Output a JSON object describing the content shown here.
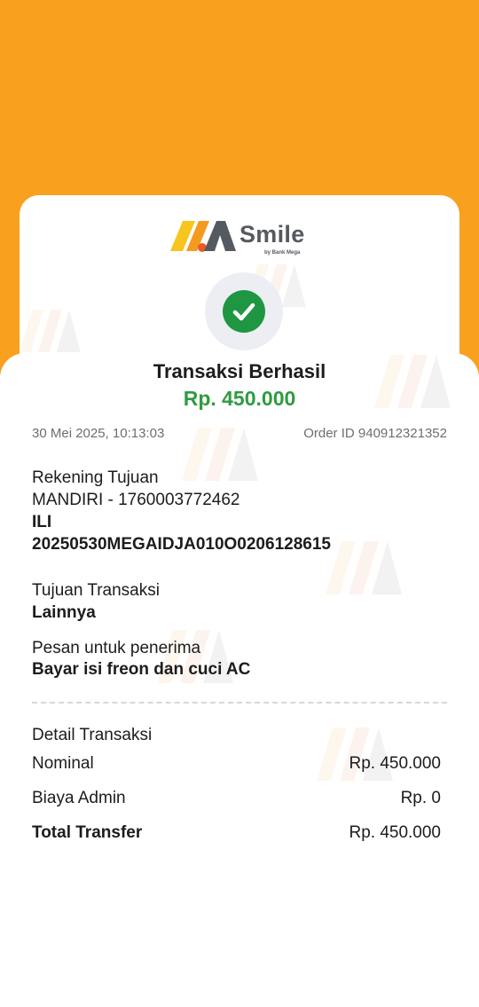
{
  "colors": {
    "background_top": "#f9a01f",
    "success_green": "#1f9642",
    "amount_green": "#2e9b41",
    "text_dark": "#1c1c1c",
    "text_muted": "#6e6e6e"
  },
  "logo": {
    "brand": "Smile",
    "sub": "by Bank Mega",
    "icon": "smile-logo-icon"
  },
  "status": {
    "icon": "check-icon",
    "title": "Transaksi Berhasil",
    "amount": "Rp. 450.000"
  },
  "meta": {
    "datetime": "30 Mei 2025, 10:13:03",
    "order_id": "Order ID 940912321352"
  },
  "rekening": {
    "label": "Rekening Tujuan",
    "account": "MANDIRI - 1760003772462",
    "name": "ILI",
    "reference": "20250530MEGAIDJA010O0206128615"
  },
  "tujuan": {
    "label": "Tujuan Transaksi",
    "value": "Lainnya"
  },
  "pesan": {
    "label": "Pesan untuk penerima",
    "value": "Bayar isi freon dan cuci AC"
  },
  "detail": {
    "heading": "Detail Transaksi",
    "rows": [
      {
        "label": "Nominal",
        "value": "Rp. 450.000"
      },
      {
        "label": "Biaya Admin",
        "value": "Rp. 0"
      },
      {
        "label": "Total Transfer",
        "value": "Rp. 450.000"
      }
    ]
  }
}
